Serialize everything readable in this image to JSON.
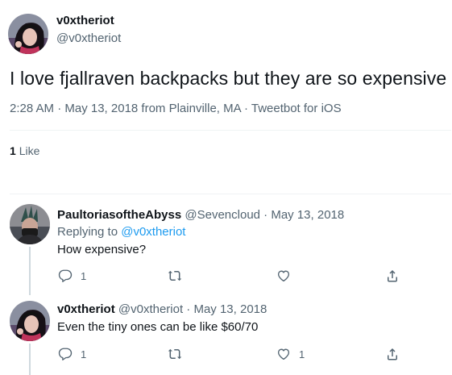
{
  "main_tweet": {
    "name": "v0xtheriot",
    "handle": "@v0xtheriot",
    "text": "I love fjallraven backpacks but they are so expensive",
    "meta": "2:28 AM · May 13, 2018 from Plainville, MA · Tweetbot for iOS",
    "likes_count": "1",
    "likes_label": "Like"
  },
  "replies": [
    {
      "name": "PaultoriasoftheAbyss",
      "handle_date": "@Sevencloud · May 13, 2018",
      "replying_prefix": "Replying to ",
      "replying_handle": "@v0xtheriot",
      "text": "How expensive?",
      "reply_count": "1",
      "retweet_count": "",
      "like_count": ""
    },
    {
      "name": "v0xtheriot",
      "handle_date": "@v0xtheriot · May 13, 2018",
      "text": "Even the tiny ones can be like $60/70",
      "reply_count": "1",
      "retweet_count": "",
      "like_count": "1"
    }
  ],
  "icons": [
    "reply-icon",
    "retweet-icon",
    "like-icon",
    "share-icon"
  ],
  "colors": {
    "text": "#0f1419",
    "secondary": "#536471",
    "link": "#1d9bf0",
    "divider": "#eff3f4"
  }
}
